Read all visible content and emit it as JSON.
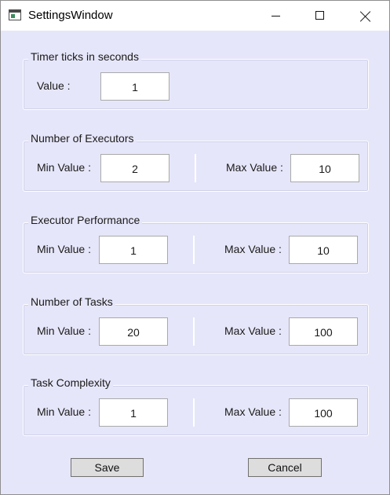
{
  "window": {
    "title": "SettingsWindow"
  },
  "groups": {
    "timer": {
      "legend": "Timer ticks in seconds",
      "value_label": "Value :",
      "value": "1"
    },
    "executors": {
      "legend": "Number of Executors",
      "min_label": "Min Value :",
      "min": "2",
      "max_label": "Max Value :",
      "max": "10"
    },
    "performance": {
      "legend": "Executor Performance",
      "min_label": "Min Value :",
      "min": "1",
      "max_label": "Max Value :",
      "max": "10"
    },
    "tasks": {
      "legend": "Number of Tasks",
      "min_label": "Min Value :",
      "min": "20",
      "max_label": "Max Value :",
      "max": "100"
    },
    "complexity": {
      "legend": "Task Complexity",
      "min_label": "Min Value :",
      "min": "1",
      "max_label": "Max Value :",
      "max": "100"
    }
  },
  "buttons": {
    "save": "Save",
    "cancel": "Cancel"
  }
}
